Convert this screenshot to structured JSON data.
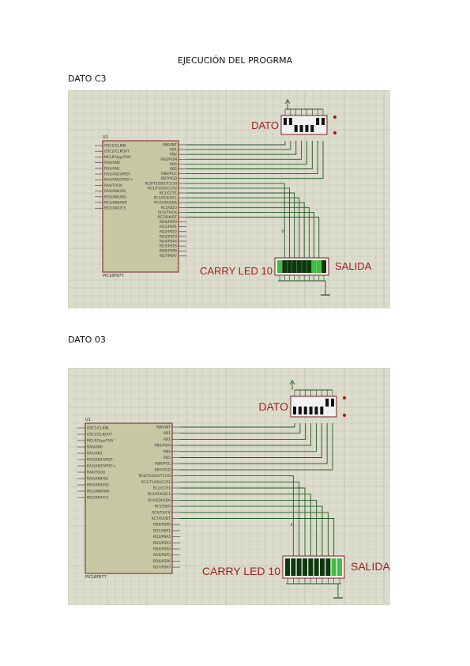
{
  "document": {
    "title": "EJECUCIÓN DEL PROGRMA"
  },
  "figures": [
    {
      "caption": "DATO C3",
      "chip_ref": "U1",
      "chip_part": "PIC16F877",
      "switch_label": "DATO",
      "led_label": "CARRY  LED 10",
      "output_label": "SALIDA"
    },
    {
      "caption": "DATO 03",
      "chip_ref": "U1",
      "chip_part": "PIC16F877",
      "switch_label": "DATO",
      "led_label": "CARRY  LED 10",
      "output_label": "SALIDA"
    }
  ],
  "chip_pins": {
    "left": [
      "OSC1/CLKIN",
      "OSC2/CLKOUT",
      "MCLR/Vpp/THV",
      "RA0/AN0",
      "RA1/AN1",
      "RA2/AN2/VREF-",
      "RA3/AN3/VREF+",
      "RA4/T0CKI",
      "RA5/AN4/SS",
      "RE0/AN5/RD",
      "RE1/AN6/WR",
      "RE2/AN7/CS"
    ],
    "right": [
      "RB0/INT",
      "RB1",
      "RB2",
      "RB3/PGM",
      "RB4",
      "RB5",
      "RB6/PGC",
      "RB7/PGD",
      "RC0/T1OSO/T1CKI",
      "RC1/T1OSI/CCP2",
      "RC2/CCP1",
      "RC3/SCK/SCL",
      "RC4/SDI/SDA",
      "RC5/SDO",
      "RC6/TX/CK",
      "RC7/RX/DT",
      "RD0/PSP0",
      "RD1/PSP1",
      "RD2/PSP2",
      "RD3/PSP3",
      "RD4/PSP4",
      "RD5/PSP5",
      "RD6/PSP6",
      "RD7/PSP7"
    ]
  }
}
